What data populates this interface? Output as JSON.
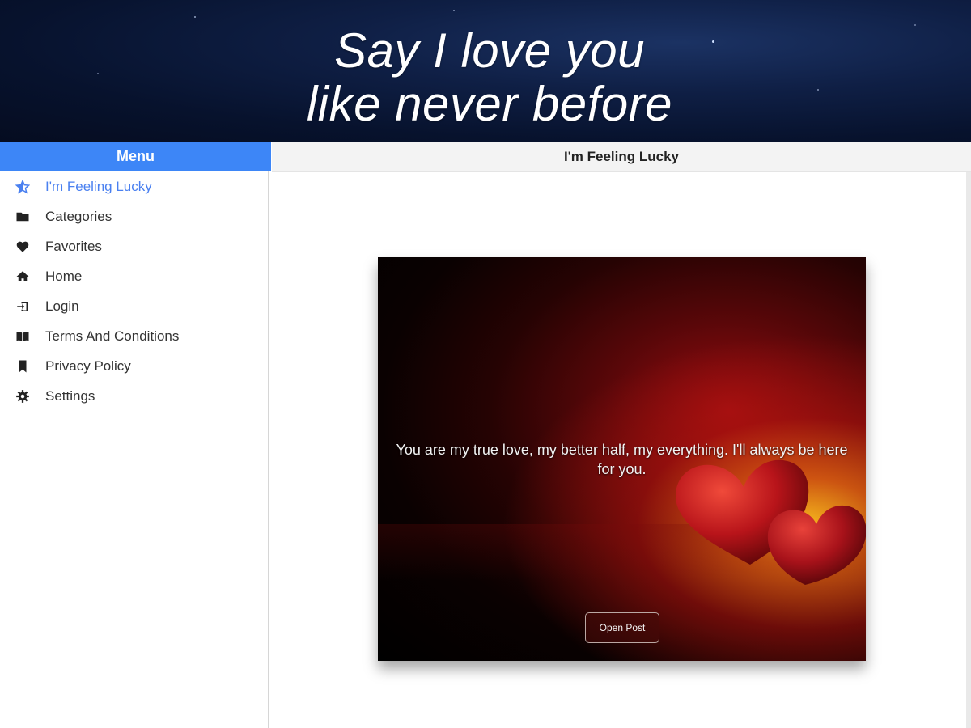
{
  "banner": {
    "title_line1": "Say I love you",
    "title_line2": "like never before"
  },
  "sidebar": {
    "header": "Menu",
    "items": [
      {
        "label": "I'm Feeling Lucky",
        "icon": "star-half-icon",
        "active": true
      },
      {
        "label": "Categories",
        "icon": "folder-icon",
        "active": false
      },
      {
        "label": "Favorites",
        "icon": "heart-icon",
        "active": false
      },
      {
        "label": "Home",
        "icon": "home-icon",
        "active": false
      },
      {
        "label": "Login",
        "icon": "login-icon",
        "active": false
      },
      {
        "label": "Terms And Conditions",
        "icon": "book-icon",
        "active": false
      },
      {
        "label": "Privacy Policy",
        "icon": "bookmark-icon",
        "active": false
      },
      {
        "label": "Settings",
        "icon": "gear-icon",
        "active": false
      }
    ]
  },
  "main": {
    "header": "I'm Feeling Lucky",
    "card": {
      "quote": "You are my true love, my better half, my everything. I'll always be here for you.",
      "button_label": "Open Post"
    }
  },
  "colors": {
    "accent": "#3d86f7",
    "active_item": "#4a80f0",
    "banner_bg": "#0b1a3d"
  }
}
